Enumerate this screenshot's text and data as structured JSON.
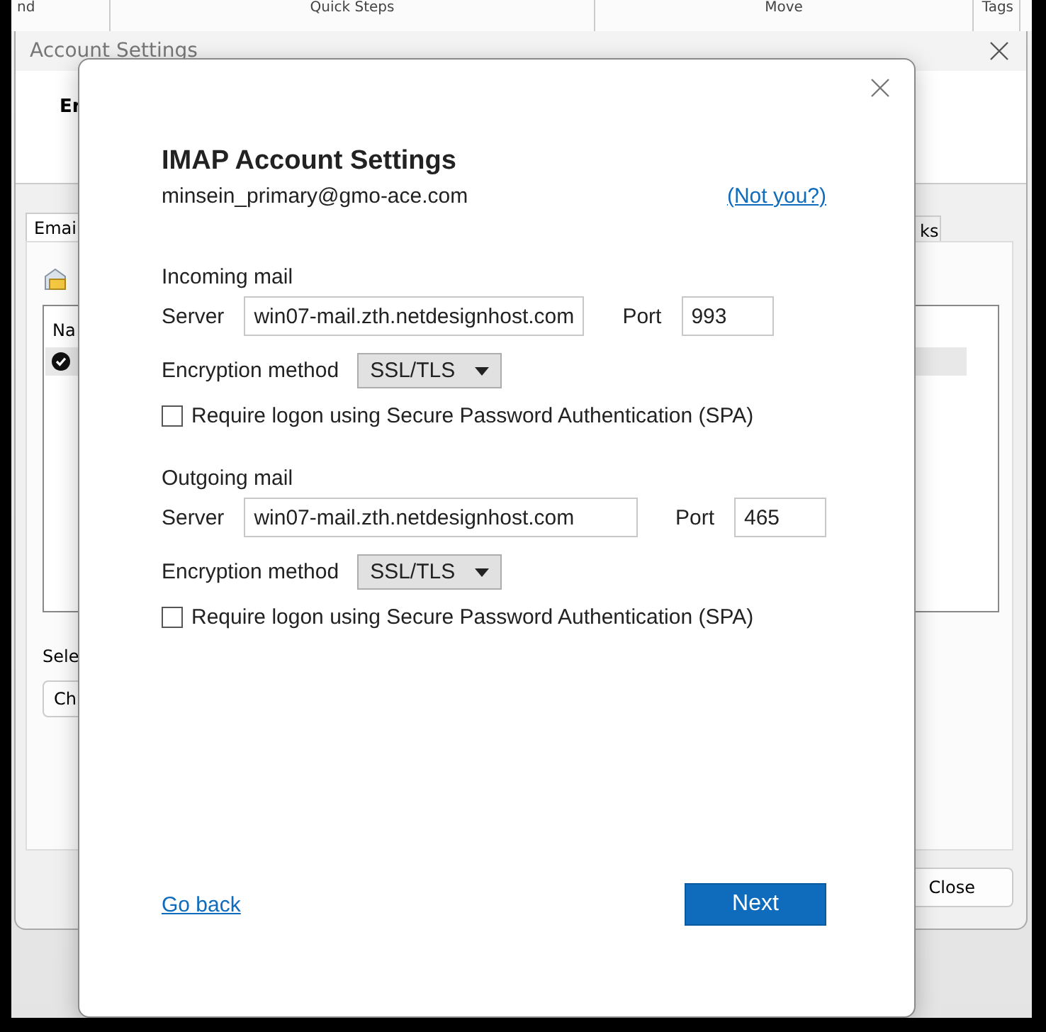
{
  "background_ribbon": {
    "groups": [
      "nd",
      "Quick Steps",
      "Move",
      "Tags"
    ]
  },
  "background_window": {
    "title": "Account Settings",
    "heading": "Er",
    "tabs": [
      {
        "label": "Emai",
        "selected": true
      },
      {
        "label": "ks",
        "selected": false
      }
    ],
    "list_header": "Na",
    "prompt": "Sele",
    "change_button": "Ch",
    "close_button": "Close"
  },
  "dialog": {
    "title": "IMAP Account Settings",
    "email": "minsein_primary@gmo-ace.com",
    "not_you_link": "(Not you?)",
    "sections": [
      {
        "heading": "Incoming mail",
        "server_label": "Server",
        "server": "win07-mail.zth.netdesignhost.com",
        "port_label": "Port",
        "port": "993",
        "encryption_label": "Encryption method",
        "encryption": "SSL/TLS",
        "spa_label": "Require logon using Secure Password Authentication (SPA)",
        "spa_checked": false
      },
      {
        "heading": "Outgoing mail",
        "server_label": "Server",
        "server": "win07-mail.zth.netdesignhost.com",
        "port_label": "Port",
        "port": "465",
        "encryption_label": "Encryption method",
        "encryption": "SSL/TLS",
        "spa_label": "Require logon using Secure Password Authentication (SPA)",
        "spa_checked": false
      }
    ],
    "back_link": "Go back",
    "next_button": "Next"
  }
}
